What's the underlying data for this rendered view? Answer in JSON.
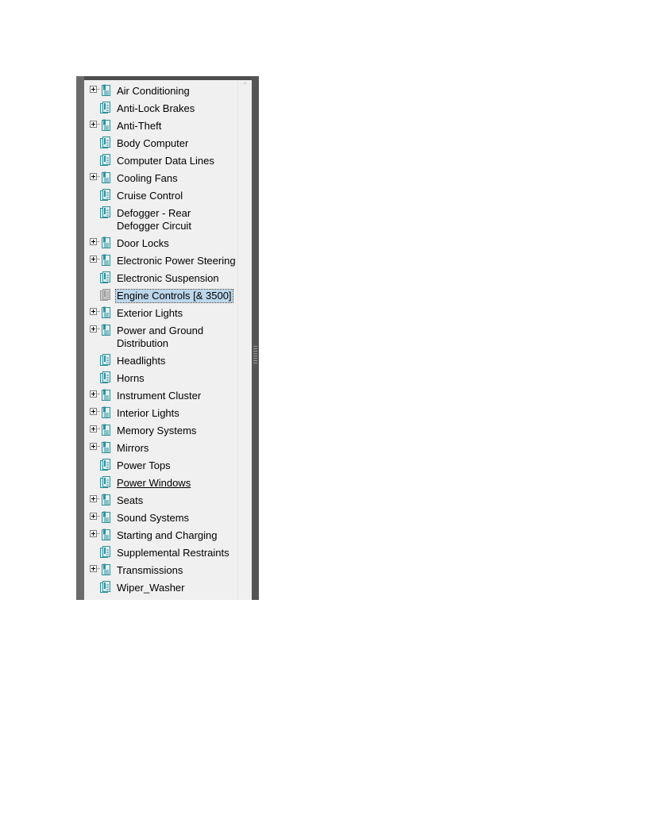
{
  "tree": {
    "items": [
      {
        "label": "Air Conditioning",
        "expandable": true,
        "icon": "book-stack-icon"
      },
      {
        "label": "Anti-Lock Brakes",
        "expandable": false,
        "icon": "document-pages-icon"
      },
      {
        "label": "Anti-Theft",
        "expandable": true,
        "icon": "book-stack-icon"
      },
      {
        "label": "Body Computer",
        "expandable": false,
        "icon": "document-pages-icon"
      },
      {
        "label": "Computer Data Lines",
        "expandable": false,
        "icon": "document-pages-icon"
      },
      {
        "label": "Cooling Fans",
        "expandable": true,
        "icon": "book-stack-icon"
      },
      {
        "label": "Cruise Control",
        "expandable": false,
        "icon": "document-pages-icon"
      },
      {
        "label": "Defogger - Rear Defogger Circuit",
        "expandable": false,
        "icon": "document-pages-icon",
        "wrapped": true
      },
      {
        "label": "Door Locks",
        "expandable": true,
        "icon": "book-stack-icon"
      },
      {
        "label": "Electronic Power Steering",
        "expandable": true,
        "icon": "book-stack-icon"
      },
      {
        "label": "Electronic Suspension",
        "expandable": false,
        "icon": "document-pages-icon"
      },
      {
        "label": "Engine Controls [& 3500]",
        "expandable": false,
        "icon": "document-pages-gray-icon",
        "selected": true
      },
      {
        "label": "Exterior Lights",
        "expandable": true,
        "icon": "book-stack-icon"
      },
      {
        "label": "Power and Ground Distribution",
        "expandable": true,
        "icon": "book-stack-icon",
        "wrapped": true
      },
      {
        "label": "Headlights",
        "expandable": false,
        "icon": "document-pages-icon"
      },
      {
        "label": "Horns",
        "expandable": false,
        "icon": "document-pages-icon"
      },
      {
        "label": "Instrument Cluster",
        "expandable": true,
        "icon": "book-stack-icon"
      },
      {
        "label": "Interior Lights",
        "expandable": true,
        "icon": "book-stack-icon"
      },
      {
        "label": "Memory Systems",
        "expandable": true,
        "icon": "book-stack-icon"
      },
      {
        "label": "Mirrors",
        "expandable": true,
        "icon": "book-stack-icon"
      },
      {
        "label": "Power Tops",
        "expandable": false,
        "icon": "document-pages-icon"
      },
      {
        "label": "Power Windows ",
        "expandable": false,
        "icon": "document-pages-icon",
        "hovered": true
      },
      {
        "label": "Seats",
        "expandable": true,
        "icon": "book-stack-icon"
      },
      {
        "label": "Sound Systems",
        "expandable": true,
        "icon": "book-stack-icon"
      },
      {
        "label": "Starting and Charging",
        "expandable": true,
        "icon": "book-stack-icon"
      },
      {
        "label": "Supplemental Restraints",
        "expandable": false,
        "icon": "document-pages-icon"
      },
      {
        "label": "Transmissions",
        "expandable": true,
        "icon": "book-stack-icon"
      },
      {
        "label": "Wiper_Washer",
        "expandable": false,
        "icon": "document-pages-icon"
      }
    ]
  },
  "colors": {
    "selection": "#bcd7ec",
    "icon_teal": "#2f8f9a",
    "icon_gray": "#9a9a9a"
  }
}
